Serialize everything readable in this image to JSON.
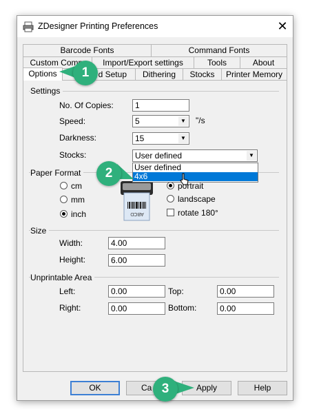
{
  "window": {
    "title": "ZDesigner Printing Preferences",
    "close_glyph": "✕"
  },
  "tabs": {
    "row1": [
      "Barcode Fonts",
      "Command Fonts"
    ],
    "row2": [
      "Custom Comm",
      "Import/Export settings",
      "Tools",
      "About"
    ],
    "row3": [
      "Options",
      "d Setup",
      "Dithering",
      "Stocks",
      "Printer Memory"
    ]
  },
  "settings": {
    "group": "Settings",
    "copies_label": "No. Of Copies:",
    "copies_value": "1",
    "speed_label": "Speed:",
    "speed_value": "5",
    "speed_unit": "\"/s",
    "darkness_label": "Darkness:",
    "darkness_value": "15",
    "stocks_label": "Stocks:",
    "stocks_value": "User defined",
    "stocks_options": [
      "User defined",
      "4x6"
    ]
  },
  "paper_format": {
    "group": "Paper Format",
    "units": [
      "cm",
      "mm",
      "inch"
    ],
    "selected_unit": "inch",
    "orientation": [
      "portrait",
      "landscape"
    ],
    "selected_orientation": "portrait",
    "rotate_label": "rotate 180°",
    "label_text": "ABCD"
  },
  "size": {
    "group": "Size",
    "width_label": "Width:",
    "width_value": "4.00",
    "height_label": "Height:",
    "height_value": "6.00"
  },
  "unprintable": {
    "group": "Unprintable Area",
    "left_label": "Left:",
    "left_value": "0.00",
    "top_label": "Top:",
    "top_value": "0.00",
    "right_label": "Right:",
    "right_value": "0.00",
    "bottom_label": "Bottom:",
    "bottom_value": "0.00"
  },
  "buttons": {
    "ok": "OK",
    "cancel": "Ca",
    "apply": "Apply",
    "help": "Help"
  },
  "callouts": [
    "1",
    "2",
    "3"
  ],
  "colors": {
    "callout": "#2fb07c",
    "selection": "#0078d7",
    "default_border": "#3c7fd4"
  }
}
